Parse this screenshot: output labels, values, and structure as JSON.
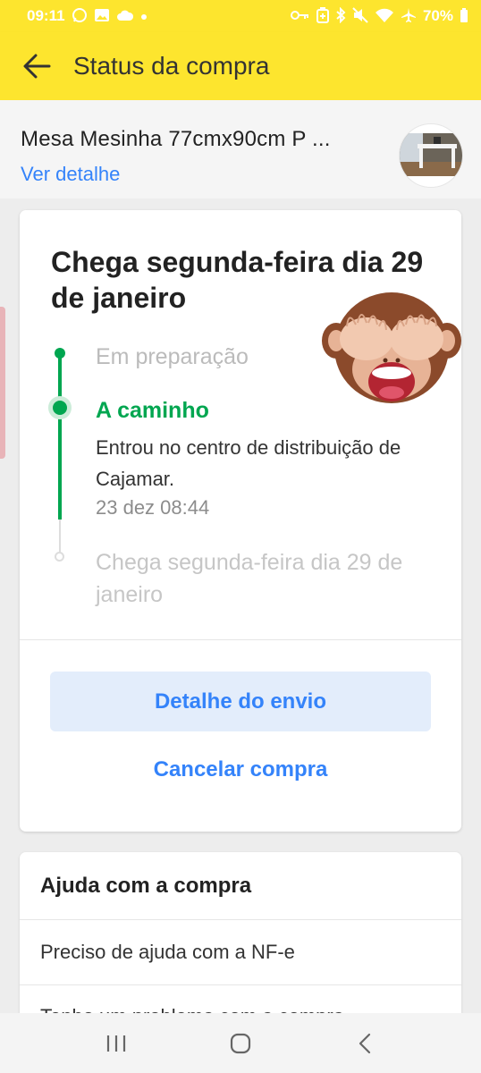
{
  "status_bar": {
    "time": "09:11",
    "battery": "70%",
    "icons_left": [
      "whatsapp-icon",
      "image-icon",
      "cloud-icon",
      "dot-icon"
    ],
    "icons_right": [
      "key-icon",
      "battery-saver-icon",
      "bluetooth-icon",
      "mute-icon",
      "wifi-icon",
      "airplane-icon",
      "battery-icon"
    ]
  },
  "app_bar": {
    "title": "Status da compra",
    "back_icon": "arrow-left-icon",
    "background_color": "#fde52e"
  },
  "product": {
    "name": "Mesa Mesinha 77cmx90cm P ...",
    "detail_link": "Ver detalhe"
  },
  "status_card": {
    "arrival_title": "Chega segunda-feira dia 29 de janeiro",
    "timeline": [
      {
        "label": "Em preparação",
        "state": "done"
      },
      {
        "label": "A caminho",
        "state": "current",
        "description": "Entrou no centro de distribuição de Cajamar.",
        "date": "23 dez 08:44"
      },
      {
        "label": "Chega segunda-feira dia 29 de janeiro",
        "state": "pending"
      }
    ],
    "primary_button": "Detalhe do envio",
    "secondary_button": "Cancelar compra",
    "sticker": "see-no-evil-monkey"
  },
  "help": {
    "title": "Ajuda com a compra",
    "items": [
      "Preciso de ajuda com a NF-e",
      "Tenho um problema com a compra"
    ]
  },
  "colors": {
    "accent_blue": "#3483fa",
    "success_green": "#00a650",
    "brand_yellow": "#fde52e"
  },
  "nav_bar": {
    "buttons": [
      "recent-apps-icon",
      "home-icon",
      "back-icon"
    ]
  }
}
